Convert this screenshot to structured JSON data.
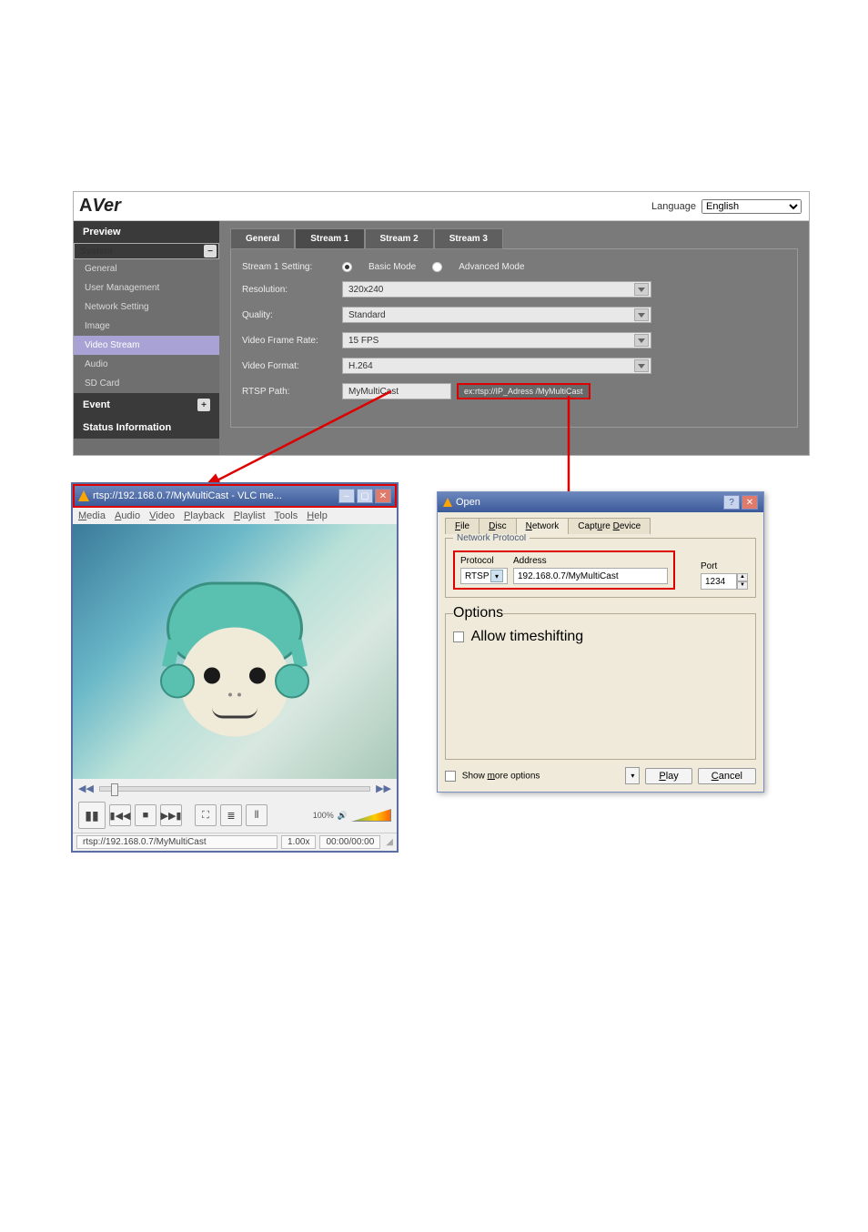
{
  "brand": "AVer",
  "language": {
    "label": "Language",
    "value": "English"
  },
  "sidebar": {
    "sections": [
      {
        "title": "Preview",
        "items": []
      },
      {
        "title": "System",
        "chip": "−",
        "items": [
          {
            "label": "General"
          },
          {
            "label": "User Management"
          },
          {
            "label": "Network Setting"
          },
          {
            "label": "Image"
          },
          {
            "label": "Video Stream",
            "active": true
          },
          {
            "label": "Audio"
          },
          {
            "label": "SD Card"
          }
        ]
      },
      {
        "title": "Event",
        "chip": "+",
        "items": []
      },
      {
        "title": "Status Information",
        "items": []
      }
    ]
  },
  "tabs": [
    "General",
    "Stream 1",
    "Stream 2",
    "Stream 3"
  ],
  "active_tab": 1,
  "form": {
    "setting_label": "Stream 1 Setting:",
    "basic": "Basic Mode",
    "advanced": "Advanced Mode",
    "resolution_label": "Resolution:",
    "resolution": "320x240",
    "quality_label": "Quality:",
    "quality": "Standard",
    "fps_label": "Video Frame Rate:",
    "fps": "15 FPS",
    "format_label": "Video Format:",
    "format": "H.264",
    "rtsp_label": "RTSP Path:",
    "rtsp_value": "MyMultiCast",
    "rtsp_hint": "ex:rtsp://IP_Adress /MyMultiCast"
  },
  "vlc": {
    "title": "rtsp://192.168.0.7/MyMultiCast - VLC me...",
    "menu": [
      "Media",
      "Audio",
      "Video",
      "Playback",
      "Playlist",
      "Tools",
      "Help"
    ],
    "menu_underline": [
      "M",
      "A",
      "V",
      "P",
      "P",
      "T",
      "H"
    ],
    "volume_pct": "100%",
    "status_path": "rtsp://192.168.0.7/MyMultiCast",
    "speed": "1.00x",
    "time": "00:00/00:00"
  },
  "open": {
    "title": "Open",
    "tabs": [
      "File",
      "Disc",
      "Network",
      "Capture Device"
    ],
    "tabs_underline": [
      "F",
      "D",
      "N",
      "D"
    ],
    "active_tab": 2,
    "fieldset": "Network Protocol",
    "protocol_label": "Protocol",
    "protocol": "RTSP",
    "address_label": "Address",
    "address": "192.168.0.7/MyMultiCast",
    "port_label": "Port",
    "port": "1234",
    "options_legend": "Options",
    "timeshift": "Allow timeshifting",
    "more": "Show more options",
    "play": "Play",
    "cancel": "Cancel"
  }
}
